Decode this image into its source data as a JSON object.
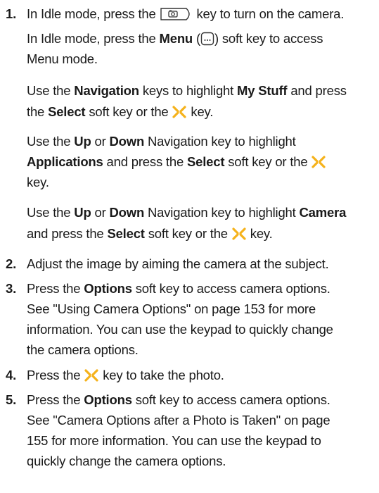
{
  "steps": [
    {
      "number": "1.",
      "main": {
        "pre": "In Idle mode, press the ",
        "post": " key to turn on the camera."
      },
      "alternatives": [
        {
          "l1_pre": "In Idle mode, press the ",
          "l1_bold": "Menu",
          "l1_paren_open": " (",
          "l1_post": ") soft key to access",
          "l2": "Menu mode."
        },
        {
          "l1_pre": "Use the ",
          "l1_b1": "Navigation",
          "l1_mid": " keys to highlight ",
          "l1_b2": "My Stuff",
          "l1_post": " and press",
          "l2_pre": "the ",
          "l2_b": "Select",
          "l2_mid": " soft key or the ",
          "l2_post": " key."
        },
        {
          "l1_pre": "Use the ",
          "l1_b1": "Up",
          "l1_or": " or ",
          "l1_b2": "Down",
          "l1_post": " Navigation key to highlight",
          "l2_b": "Applications",
          "l2_mid": " and press the ",
          "l2_b2": "Select",
          "l2_post": " soft key or the ",
          "l3": "key."
        },
        {
          "l1_pre": "Use the ",
          "l1_b1": "Up",
          "l1_or": " or ",
          "l1_b2": "Down",
          "l1_mid": " Navigation key to highlight ",
          "l1_b3": "Camera",
          "l2_pre": "and press the ",
          "l2_b": "Select",
          "l2_mid": " soft key or the ",
          "l2_post": " key."
        }
      ]
    },
    {
      "number": "2.",
      "text": "Adjust the image by aiming the camera at the subject."
    },
    {
      "number": "3.",
      "l1_pre": "Press the ",
      "l1_b": "Options",
      "l1_post": " soft key to access camera options.",
      "l2": "See \"Using Camera Options\" on page 153 for more",
      "l3": "information. You can use the keypad to quickly change",
      "l4": "the camera options."
    },
    {
      "number": "4.",
      "pre": "Press the ",
      "post": " key to take the photo."
    },
    {
      "number": "5.",
      "l1_pre": "Press the ",
      "l1_b": "Options",
      "l1_post": " soft key to access camera options.",
      "l2": "See \"Camera Options after a Photo is Taken\" on page",
      "l3": "155 for more information. You can use the keypad to",
      "l4": "quickly change the camera options."
    }
  ],
  "icons": {
    "camera_key": "camera-key-icon",
    "menu_key": "menu-soft-key-icon",
    "nav_center": "navigation-center-key-icon",
    "nav_color": "#f5b21b"
  }
}
